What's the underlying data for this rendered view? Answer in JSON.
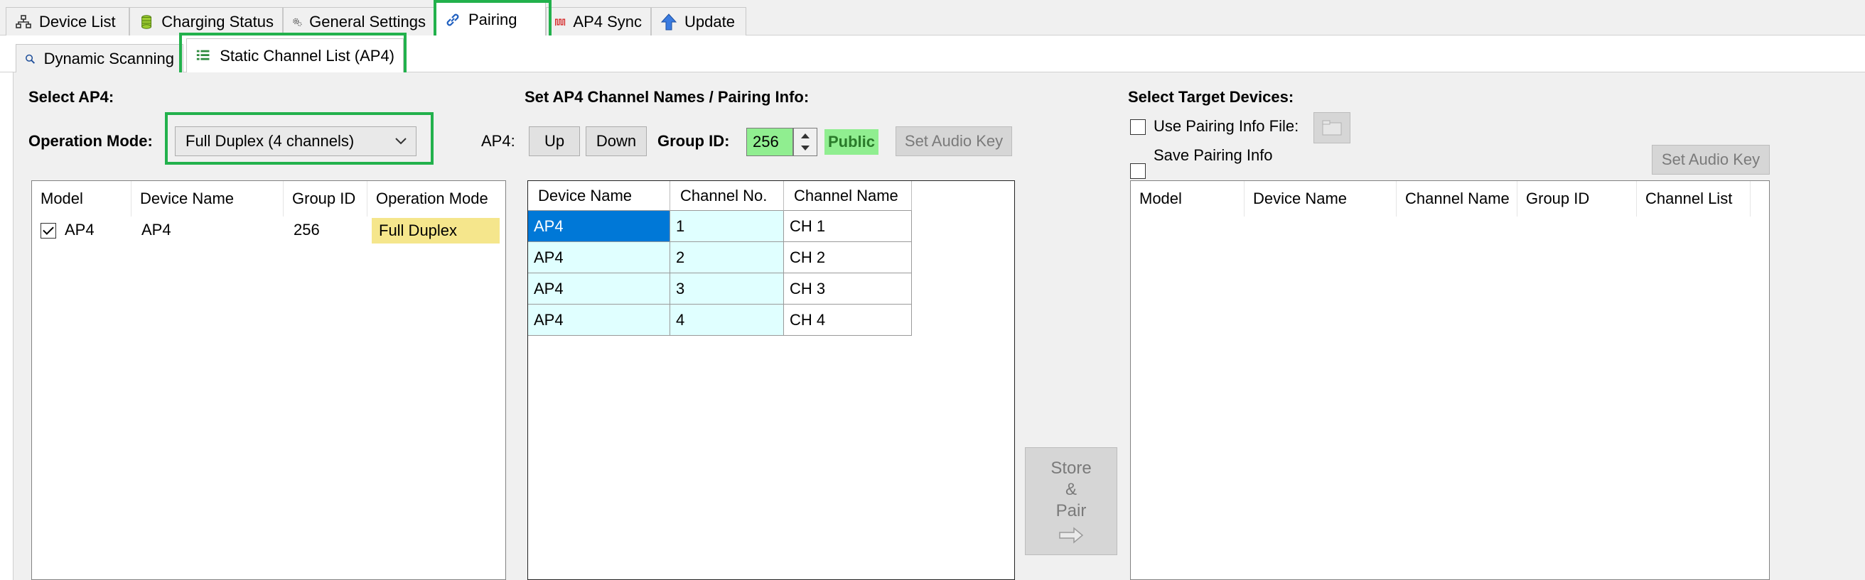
{
  "top_tabs": [
    {
      "label": "Device List",
      "icon": "device-tree-icon"
    },
    {
      "label": "Charging Status",
      "icon": "battery-stack-icon"
    },
    {
      "label": "General Settings",
      "icon": "gears-icon"
    },
    {
      "label": "Pairing",
      "icon": "link-icon"
    },
    {
      "label": "AP4 Sync",
      "icon": "sync-pulse-icon"
    },
    {
      "label": "Update",
      "icon": "up-arrow-icon"
    }
  ],
  "sub_tabs": [
    {
      "label": "Dynamic Scanning",
      "icon": "magnifier-icon"
    },
    {
      "label": "Static Channel List (AP4)",
      "icon": "list-icon"
    }
  ],
  "select_ap4": {
    "heading": "Select AP4:",
    "operation_mode_label": "Operation Mode:",
    "operation_mode_value": "Full Duplex (4 channels)",
    "columns": [
      "Model",
      "Device Name",
      "Group ID",
      "Operation Mode"
    ],
    "rows": [
      {
        "model": "AP4",
        "device_name": "AP4",
        "group_id": "256",
        "operation_mode": "Full Duplex",
        "checked": true
      }
    ]
  },
  "set_names": {
    "heading": "Set AP4 Channel Names / Pairing Info:",
    "ap4_label": "AP4:",
    "up_label": "Up",
    "down_label": "Down",
    "group_id_label": "Group ID:",
    "group_id_value": "256",
    "public_label": "Public",
    "set_audio_key_label": "Set Audio Key",
    "columns": [
      "Device Name",
      "Channel No.",
      "Channel Name"
    ],
    "rows": [
      {
        "device": "AP4",
        "channel_no": "1",
        "channel_name": "CH 1"
      },
      {
        "device": "AP4",
        "channel_no": "2",
        "channel_name": "CH 2"
      },
      {
        "device": "AP4",
        "channel_no": "3",
        "channel_name": "CH 3"
      },
      {
        "device": "AP4",
        "channel_no": "4",
        "channel_name": "CH 4"
      }
    ]
  },
  "store_pair": {
    "line1": "Store",
    "line2": "&",
    "line3": "Pair"
  },
  "targets": {
    "heading": "Select Target Devices:",
    "use_pairing_file_label": "Use Pairing Info File:",
    "save_pairing_label": "Save Pairing Info",
    "set_audio_key_label": "Set Audio Key",
    "columns": [
      "Model",
      "Device Name",
      "Channel Name",
      "Group ID",
      "Channel List"
    ]
  },
  "colors": {
    "highlight_green": "#22b14c",
    "public_bg": "#90ee90",
    "mode_cell_bg": "#f5e68c",
    "row_bg": "#e0ffff",
    "selected_bg": "#0078d7"
  }
}
